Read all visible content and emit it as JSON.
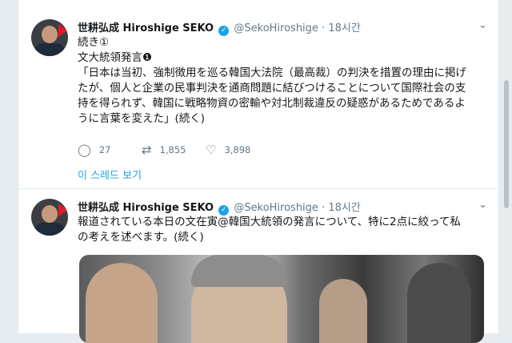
{
  "tweets": [
    {
      "author_name": "世耕弘成 Hiroshige SEKO",
      "handle": "@SekoHiroshige",
      "time": "· 18시간",
      "body_lines": [
        "続き①",
        "文大統領発言❶",
        "「日本は当初、強制徴用を巡る韓国大法院（最高裁）の判決を措置の理由に掲げ",
        "たが、個人と企業の民事判決を通商問題に結びつけることについて国際社会の支",
        "持を得られず、韓国に戦略物資の密輸や対北制裁違反の疑惑があるためであるよ",
        "うに言葉を変えた」(続く)"
      ],
      "replies": "27",
      "retweets": "1,855",
      "likes": "3,898",
      "thread_link": "이 스레드 보기"
    },
    {
      "author_name": "世耕弘成 Hiroshige SEKO",
      "handle": "@SekoHiroshige",
      "time": "· 18시간",
      "body_lines": [
        "報道されている本日の文在寅@韓国大統領の発言について、特に2点に絞って私",
        "の考えを述べます。(続く)"
      ]
    }
  ],
  "icons": {
    "verified": "verified-check-icon",
    "caret": "chevron-down-icon",
    "reply": "reply-icon",
    "retweet": "retweet-icon",
    "like": "heart-icon"
  }
}
